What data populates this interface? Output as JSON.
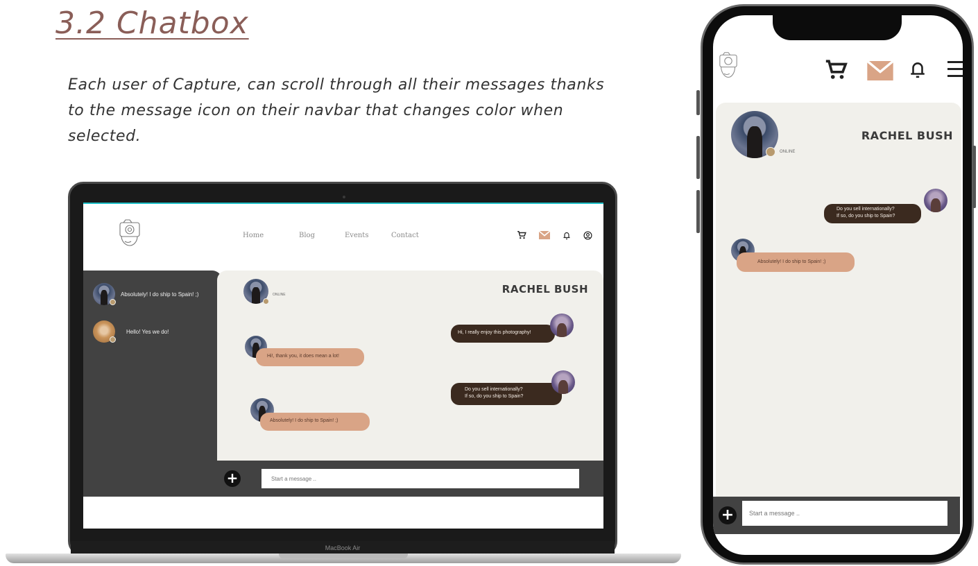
{
  "header": {
    "title": "3.2 Chatbox",
    "description": "Each user of Capture, can scroll through all their messages thanks to the message icon on their navbar that changes color when selected."
  },
  "laptop": {
    "brand_label": "MacBook Air",
    "nav": {
      "home": "Home",
      "blog": "Blog",
      "events": "Events",
      "contact": "Contact"
    },
    "icons": [
      "cart-icon",
      "mail-icon",
      "bell-icon",
      "user-icon"
    ],
    "sidebar": {
      "conversations": [
        {
          "preview": "Absolutely! I do ship to Spain! ;)"
        },
        {
          "preview": "Hello! Yes we do!"
        }
      ]
    },
    "chat": {
      "contact_name": "RACHEL BUSH",
      "status": "ONLINE",
      "messages": {
        "m1": "Hi, I really enjoy this photography!",
        "m2": "Hi!, thank you, it does mean a lot!",
        "m3_line1": "Do you sell internationally?",
        "m3_line2": "If so, do you ship to Spain?",
        "m4": "Absolutely! I do ship to Spain! ;)"
      }
    },
    "input": {
      "placeholder": "Start a message ..",
      "add_label": "+"
    }
  },
  "phone": {
    "icons": [
      "cart-icon",
      "mail-icon",
      "bell-icon",
      "menu-icon"
    ],
    "chat": {
      "contact_name": "RACHEL BUSH",
      "status": "ONLINE",
      "messages": {
        "m1_line1": "Do you sell internationally?",
        "m1_line2": "If so, do you ship to Spain?",
        "m2": "Absolutely! I do ship to Spain! ;)"
      }
    },
    "input": {
      "placeholder": "Start a message ..",
      "add_label": "+"
    }
  },
  "colors": {
    "title": "#8a5e58",
    "dark_panel": "#424242",
    "chat_bg": "#f1f0eb",
    "bubble_out": "#3b2a1f",
    "bubble_in": "#d9a486",
    "mail_active": "#d9a486",
    "screen_accent": "#1fc0c8"
  }
}
